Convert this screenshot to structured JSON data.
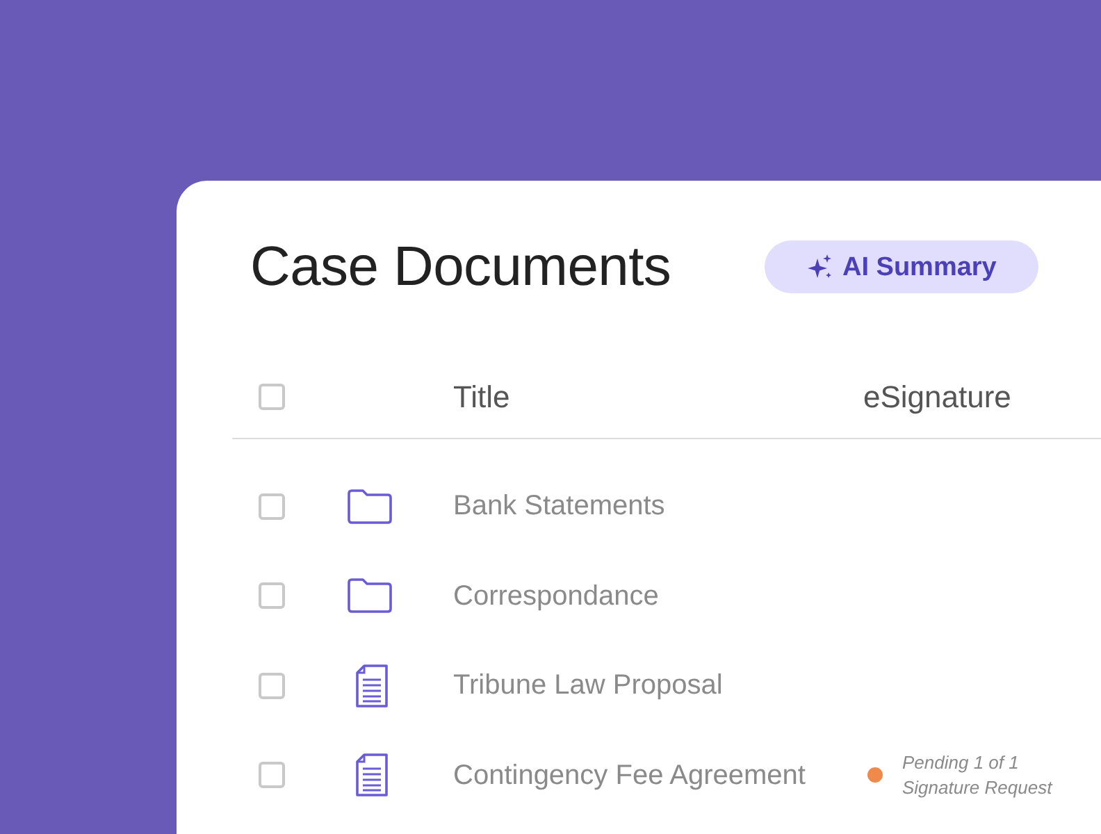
{
  "header": {
    "title": "Case Documents",
    "ai_button": {
      "label": "AI Summary"
    }
  },
  "table": {
    "select_all": {
      "checked": false
    },
    "columns": [
      "Title",
      "eSignature"
    ],
    "rows": [
      {
        "kind": "folder",
        "checked": false,
        "title": "Bank Statements"
      },
      {
        "kind": "folder",
        "checked": false,
        "title": "Correspondance"
      },
      {
        "kind": "document",
        "checked": false,
        "title": "Tribune Law Proposal"
      },
      {
        "kind": "document",
        "checked": false,
        "title": "Contingency Fee Agreement",
        "esignature": {
          "color": "#f08a4b",
          "status": "Pending 1 of 1 Signature Request"
        }
      }
    ]
  }
}
